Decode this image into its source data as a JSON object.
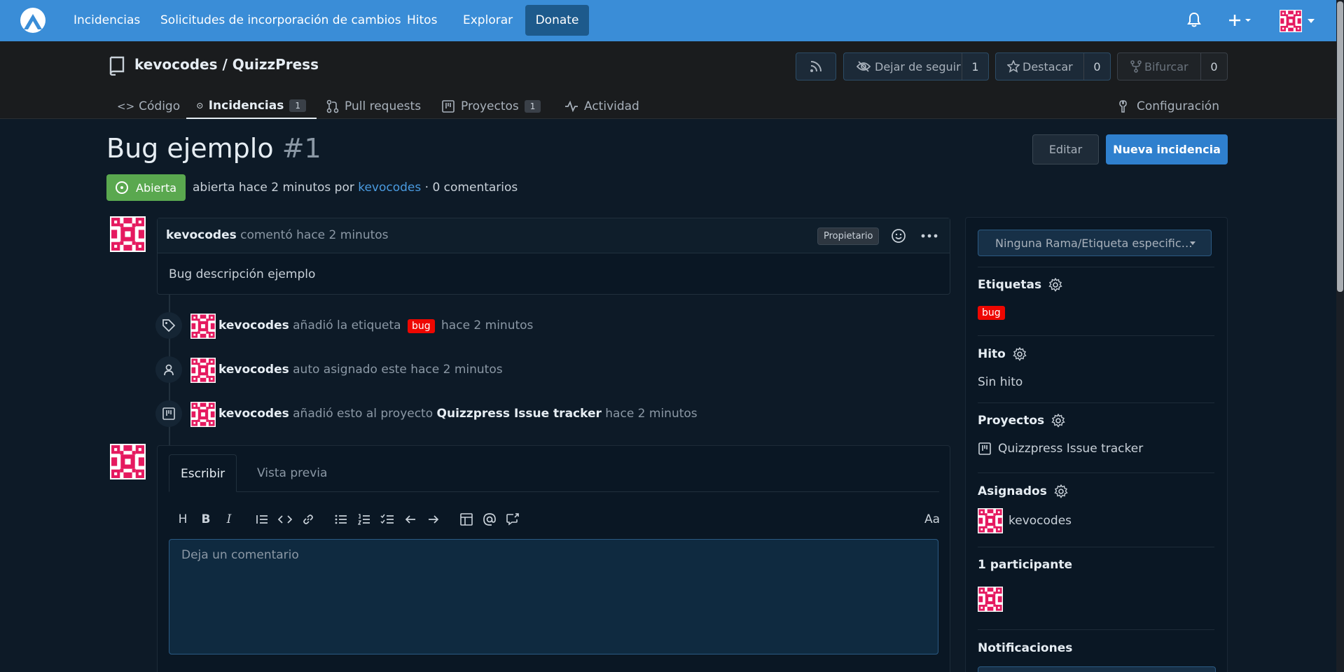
{
  "topnav": {
    "links": [
      "Incidencias",
      "Solicitudes de incorporación de cambios",
      "Hitos",
      "Explorar"
    ],
    "donate": "Donate"
  },
  "repo": {
    "title": "kevocodes / QuizzPress",
    "unwatch_label": "Dejar de seguir",
    "unwatch_count": "1",
    "star_label": "Destacar",
    "star_count": "0",
    "fork_label": "Bifurcar",
    "fork_count": "0",
    "tabs": {
      "code": "Código",
      "issues": "Incidencias",
      "issues_count": "1",
      "pulls": "Pull requests",
      "projects": "Proyectos",
      "projects_count": "1",
      "activity": "Actividad",
      "settings": "Configuración"
    }
  },
  "issue": {
    "title": "Bug ejemplo",
    "number": "#1",
    "edit_label": "Editar",
    "new_label": "Nueva incidencia",
    "state": "Abierta",
    "meta_prefix": "abierta hace 2 minutos por",
    "meta_author": "kevocodes",
    "meta_suffix": "· 0 comentarios"
  },
  "comment": {
    "author": "kevocodes",
    "action": "comentó hace 2 minutos",
    "role": "Propietario",
    "body": "Bug descripción ejemplo"
  },
  "timeline": [
    {
      "user": "kevocodes",
      "text1": "añadió la etiqueta",
      "label": "bug",
      "text2": "hace 2 minutos"
    },
    {
      "user": "kevocodes",
      "text1": "auto asignado este hace 2 minutos"
    },
    {
      "user": "kevocodes",
      "text1": "añadió esto al proyecto",
      "project": "Quizzpress Issue tracker",
      "text2": "hace 2 minutos"
    }
  ],
  "editor": {
    "tab_write": "Escribir",
    "tab_preview": "Vista previa",
    "font_toggle": "Aa",
    "placeholder": "Deja un comentario"
  },
  "sidebar": {
    "branch": "Ninguna Rama/Etiqueta especific…",
    "labels_title": "Etiquetas",
    "label_bug": "bug",
    "milestone_title": "Hito",
    "milestone_value": "Sin hito",
    "projects_title": "Proyectos",
    "project_value": "Quizzpress Issue tracker",
    "assignees_title": "Asignados",
    "assignee_value": "kevocodes",
    "participants_title": "1 participante",
    "notifications_title": "Notificaciones"
  },
  "colors": {
    "nav": "#3a8dd7",
    "open_state": "#5aa84f",
    "label_bug": "#ee0701",
    "primary_button": "#2f80ce",
    "avatar": "#e5195f"
  }
}
